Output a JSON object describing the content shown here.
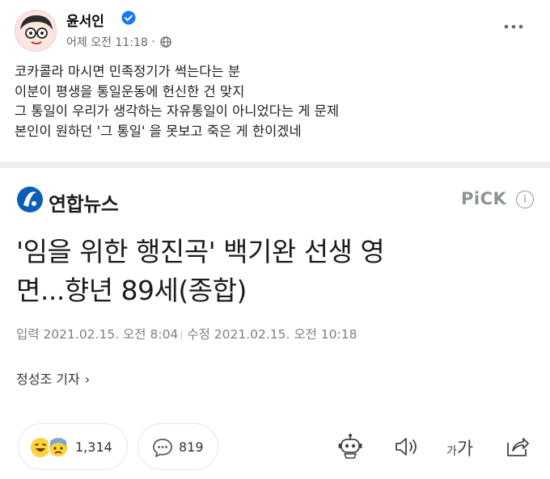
{
  "post": {
    "author": "윤서인",
    "verified": true,
    "time": "어제 오전 11:18",
    "privacy_icon": "globe-icon",
    "more_icon": "more-dots-icon",
    "lines": [
      "코카콜라 마시면 민족정기가 썩는다는 분",
      "이분이 평생을 통일운동에 헌신한 건 맞지",
      "그 통일이 우리가 생각하는 자유통일이 아니었다는 게 문제",
      "본인이 원하던 '그 통일' 을 못보고 죽은 게 한이겠네"
    ]
  },
  "article": {
    "source": "연합뉴스",
    "badge": "PiCK",
    "info_symbol": "i",
    "headline_lines": [
      "'임을 위한 행진곡' 백기완 선생 영",
      "면...향년 89세(종합)"
    ],
    "published": "입력 2021.02.15. 오전 8:04",
    "modified": "수정 2021.02.15. 오전 10:18",
    "reporter": "정성조 기자",
    "reporter_chevron": "›",
    "reaction_count": "1,314",
    "comment_count": "819",
    "font_small": "가",
    "font_big": "가"
  },
  "colors": {
    "brand_blue": "#1877f2",
    "yna_blue": "#0b5eb8",
    "pick_gray": "#8d9297",
    "separator": "#eef0f3"
  }
}
